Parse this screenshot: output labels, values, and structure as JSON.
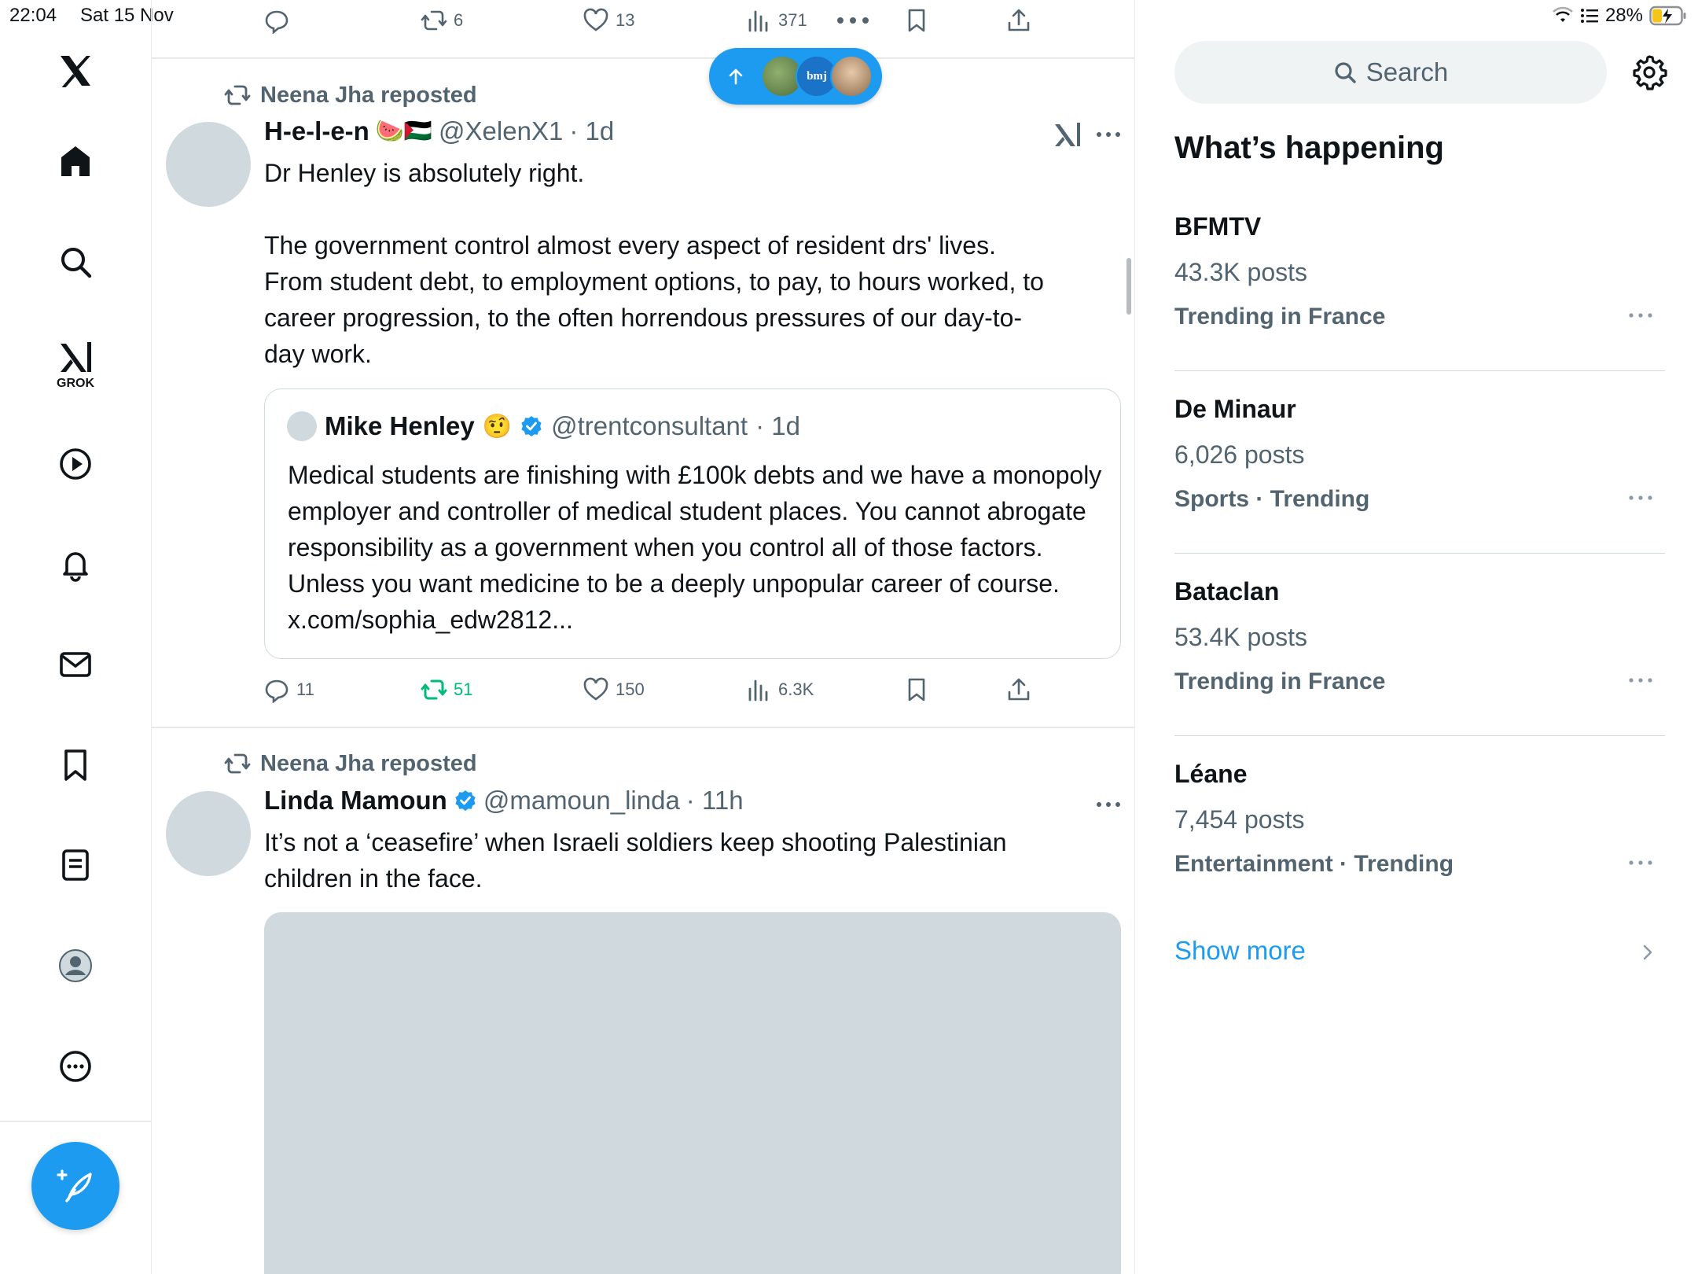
{
  "status_bar": {
    "time": "22:04",
    "date": "Sat 15 Nov",
    "battery": "28%"
  },
  "nav": {
    "grok_label": "GROK"
  },
  "feed": {
    "top_actions": {
      "replies": "",
      "reposts": "6",
      "likes": "13",
      "views": "371"
    },
    "post1": {
      "repost_by": "Neena Jha reposted",
      "name": "H-e-l-e-n",
      "flags": "🍉🇵🇸",
      "handle": "@XelenX1",
      "time": "· 1d",
      "text": "Dr Henley is absolutely right.\n\nThe government control almost every aspect of resident drs' lives. From student debt, to employment options, to pay, to hours worked, to career progression, to the often horrendous pressures of our day-to-day work.",
      "quote": {
        "name": "Mike Henley",
        "emoji": "🤨",
        "handle": "@trentconsultant",
        "time": "· 1d",
        "text": "Medical students are finishing with £100k debts and we have a monopoly employer and controller of medical student places. You cannot abrogate responsibility as a government when you control all of those factors. Unless you want medicine to be a deeply unpopular career of course. x.com/sophia_edw2812..."
      },
      "replies": "11",
      "reposts": "51",
      "likes": "150",
      "views": "6.3K"
    },
    "post2": {
      "repost_by": "Neena Jha reposted",
      "name": "Linda Mamoun",
      "handle": "@mamoun_linda",
      "time": "· 11h",
      "text": "It’s not a ‘ceasefire’ when Israeli soldiers keep shooting Palestinian children in the face."
    },
    "new_posts_pill": {
      "label": "bmj"
    }
  },
  "right": {
    "search_placeholder": "Search",
    "section_title": "What’s happening",
    "trends": [
      {
        "name": "BFMTV",
        "count": "43.3K posts",
        "meta": "Trending in France"
      },
      {
        "name": "De Minaur",
        "count": "6,026 posts",
        "meta": "Sports · Trending"
      },
      {
        "name": "Bataclan",
        "count": "53.4K posts",
        "meta": "Trending in France"
      },
      {
        "name": "Léane",
        "count": "7,454 posts",
        "meta": "Entertainment · Trending"
      }
    ],
    "show_more": "Show more"
  },
  "colors": {
    "accent": "#1d9bf0",
    "repost_green": "#00ba7c",
    "muted": "#536471"
  }
}
